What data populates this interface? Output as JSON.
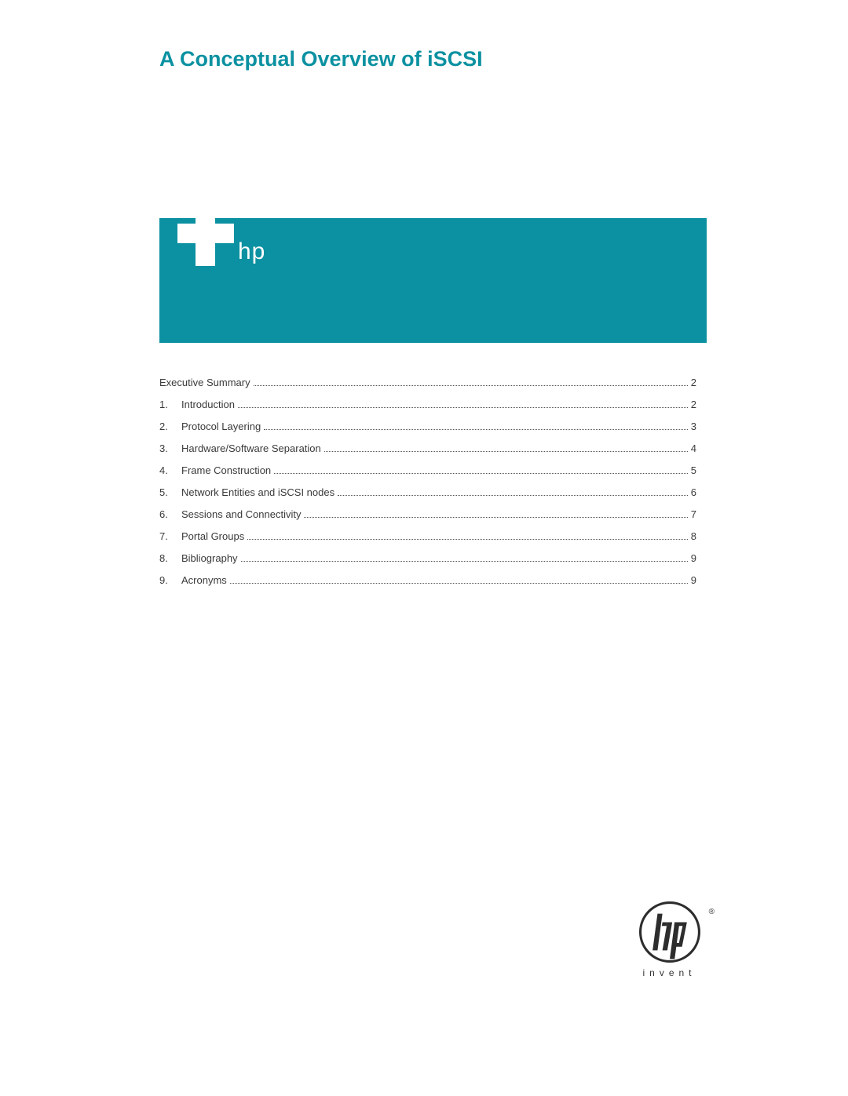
{
  "title": "A Conceptual Overview of iSCSI",
  "banner": {
    "brand": "hp"
  },
  "toc": {
    "first": {
      "label": "Executive Summary",
      "page": "2"
    },
    "items": [
      {
        "num": "1.",
        "label": "Introduction",
        "page": "2"
      },
      {
        "num": "2.",
        "label": "Protocol Layering",
        "page": "3"
      },
      {
        "num": "3.",
        "label": "Hardware/Software Separation",
        "page": "4"
      },
      {
        "num": "4.",
        "label": "Frame Construction",
        "page": "5"
      },
      {
        "num": "5.",
        "label": "Network Entities and iSCSI nodes",
        "page": "6"
      },
      {
        "num": "6.",
        "label": "Sessions and Connectivity",
        "page": "7"
      },
      {
        "num": "7.",
        "label": "Portal Groups",
        "page": "8"
      },
      {
        "num": "8.",
        "label": "Bibliography",
        "page": "9"
      },
      {
        "num": "9.",
        "label": "Acronyms",
        "page": "9"
      }
    ]
  },
  "footer": {
    "tagline": "invent",
    "registered": "®"
  }
}
